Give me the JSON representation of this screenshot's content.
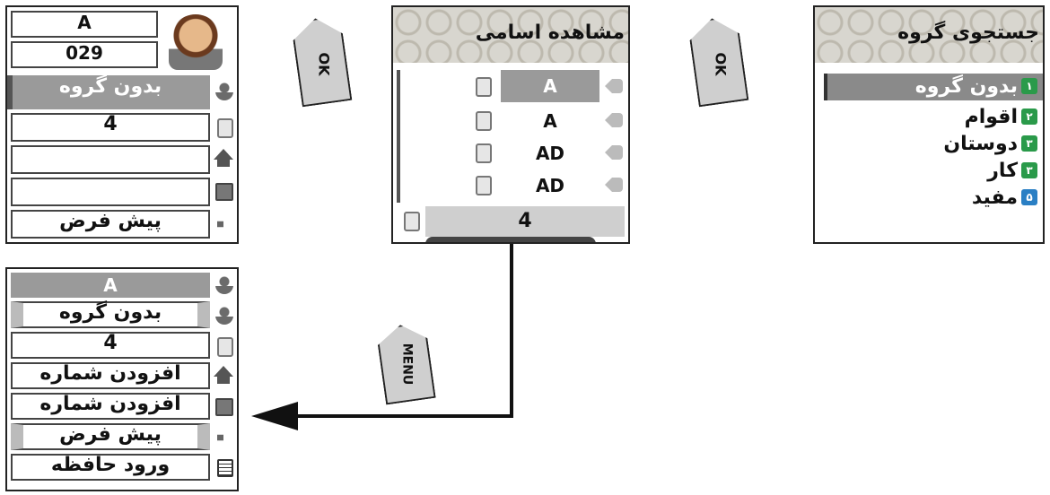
{
  "group_search": {
    "title": "جستجوی گروه",
    "items": [
      {
        "num": "۱",
        "label": "بدون گروه",
        "selected": true
      },
      {
        "num": "۲",
        "label": "اقوام",
        "selected": false
      },
      {
        "num": "۳",
        "label": "دوستان",
        "selected": false
      },
      {
        "num": "۳",
        "label": "کار",
        "selected": false
      },
      {
        "num": "۵",
        "label": "مفید",
        "selected": false
      }
    ]
  },
  "ok_key_1": {
    "label": "OK"
  },
  "ok_key_2": {
    "label": "OK"
  },
  "menu_key": {
    "label": "MENU"
  },
  "view_names": {
    "title": "مشاهده اسامی",
    "rows": [
      {
        "name": "A",
        "selected": true
      },
      {
        "name": "A",
        "selected": false
      },
      {
        "name": "AD",
        "selected": false
      },
      {
        "name": "AD",
        "selected": false
      }
    ],
    "number": "4"
  },
  "contact_detail": {
    "name": "A",
    "number": "029",
    "group": "بدون گروه",
    "phone": "4",
    "home": "",
    "office": "",
    "ringtone": "پیش فرض"
  },
  "edit_menu": {
    "name": "A",
    "group": "بدون گروه",
    "phone": "4",
    "add_home": "افزودن شماره",
    "add_office": "افزودن شماره",
    "ringtone": "پیش فرض",
    "memory": "ورود حافظه"
  }
}
